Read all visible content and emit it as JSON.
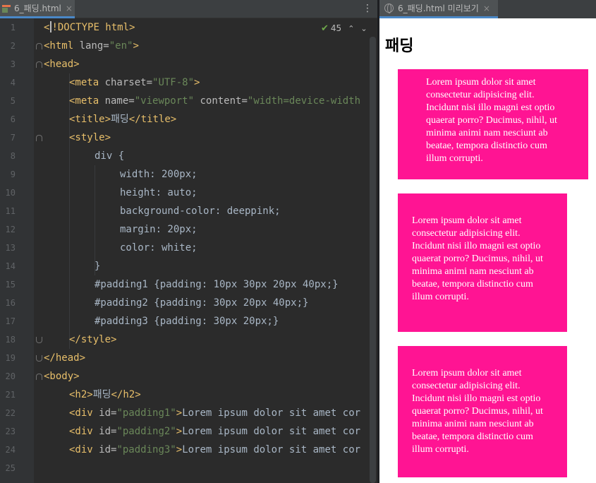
{
  "editor": {
    "tab_label": "6_패딩.html",
    "tab_close": "×",
    "menu_icon": "⋮",
    "inspection": {
      "check": "✔",
      "count": "45",
      "up": "⌃",
      "down": "⌄"
    },
    "line_numbers": [
      "1",
      "2",
      "3",
      "4",
      "5",
      "6",
      "7",
      "8",
      "9",
      "10",
      "11",
      "12",
      "13",
      "14",
      "15",
      "16",
      "17",
      "18",
      "19",
      "20",
      "21",
      "22",
      "23",
      "24",
      "25"
    ],
    "code": {
      "l1": "!DOCTYPE html>",
      "l2_open": "<html ",
      "l2_attr": "lang=",
      "l2_val": "\"en\"",
      "l2_close": ">",
      "l3": "<head>",
      "l4_open": "<meta ",
      "l4_attr": "charset=",
      "l4_val": "\"UTF-8\"",
      "l4_close": ">",
      "l5_open": "<meta ",
      "l5_attr1": "name=",
      "l5_val1": "\"viewport\"",
      "l5_attr2": " content=",
      "l5_val2": "\"width=device-width",
      "l6_open": "<title>",
      "l6_text": "패딩",
      "l6_close": "</title>",
      "l7": "<style>",
      "l8": "div {",
      "l9": "width: 200px;",
      "l10": "height: auto;",
      "l11": "background-color: deeppink;",
      "l12": "margin: 20px;",
      "l13": "color: white;",
      "l14": "}",
      "l15": "#padding1 {padding: 10px 30px 20px 40px;}",
      "l16": "#padding2 {padding: 30px 20px 40px;}",
      "l17": "#padding3 {padding: 30px 20px;}",
      "l18": "</style>",
      "l19": "</head>",
      "l20": "<body>",
      "l21_open": "<h2>",
      "l21_text": "패딩",
      "l21_close": "</h2>",
      "l22_open": "<div ",
      "l22_attr": "id=",
      "l22_val": "\"padding1\"",
      "l22_close": ">",
      "l22_text": "Lorem ipsum dolor sit amet cor",
      "l23_open": "<div ",
      "l23_attr": "id=",
      "l23_val": "\"padding2\"",
      "l23_close": ">",
      "l23_text": "Lorem ipsum dolor sit amet cor",
      "l24_open": "<div ",
      "l24_attr": "id=",
      "l24_val": "\"padding3\"",
      "l24_close": ">",
      "l24_text": "Lorem ipsum dolor sit amet cor"
    }
  },
  "preview": {
    "tab_label": "6_패딩.html 미리보기",
    "tab_close": "×",
    "heading": "패딩",
    "box_text": "Lorem ipsum dolor sit amet consectetur adipisicing elit. Incidunt nisi illo magni est optio quaerat porro? Ducimus, nihil, ut minima animi nam nesciunt ab beatae, tempora distinctio cum illum corrupti.",
    "box_color": "#ff1493"
  }
}
